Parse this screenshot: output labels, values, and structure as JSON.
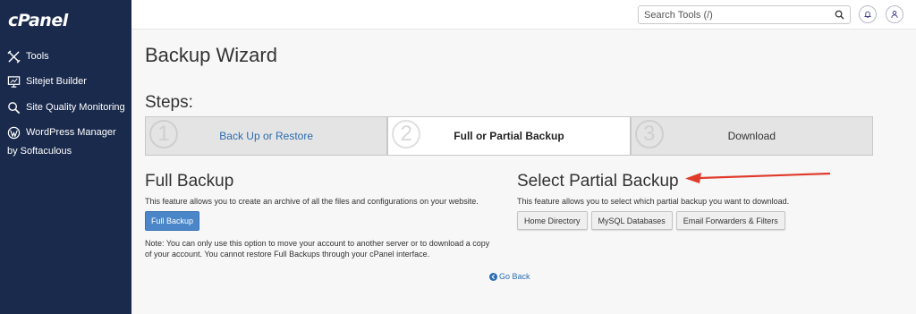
{
  "sidebar": {
    "logo": "cPanel",
    "items": [
      {
        "label": "Tools",
        "icon": "tools-icon"
      },
      {
        "label": "Sitejet Builder",
        "icon": "monitor-icon"
      },
      {
        "label": "Site Quality Monitoring",
        "icon": "magnifier-icon"
      },
      {
        "label": "WordPress Manager",
        "sub": "by Softaculous",
        "icon": "wordpress-icon"
      }
    ]
  },
  "topbar": {
    "search_placeholder": "Search Tools (/)"
  },
  "page": {
    "title": "Backup Wizard",
    "steps_heading": "Steps:",
    "steps": [
      {
        "number": "1",
        "label": "Back Up or Restore"
      },
      {
        "number": "2",
        "label": "Full or Partial Backup"
      },
      {
        "number": "3",
        "label": "Download"
      }
    ],
    "full_backup": {
      "title": "Full Backup",
      "description": "This feature allows you to create an archive of all the files and configurations on your website.",
      "button": "Full Backup",
      "note_line1": "Note: You can only use this option to move your account to another server or to download a copy",
      "note_line2": "of your account. You cannot restore Full Backups through your cPanel interface."
    },
    "partial_backup": {
      "title": "Select Partial Backup",
      "description": "This feature allows you to select which partial backup you want to download.",
      "buttons": [
        "Home Directory",
        "MySQL Databases",
        "Email Forwarders & Filters"
      ]
    },
    "go_back": "Go Back"
  },
  "colors": {
    "sidebar_bg": "#1a2a4c",
    "primary_button": "#4a86c8",
    "link": "#2b6cb0",
    "annotation_arrow": "#e03a2a"
  }
}
